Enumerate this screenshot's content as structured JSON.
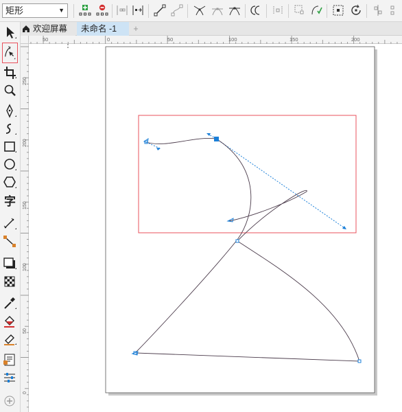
{
  "property_bar": {
    "object_type_value": "矩形",
    "icons": [
      "add-node-icon",
      "delete-node-icon",
      "join-nodes-icon",
      "break-curve-icon",
      "to-line-icon",
      "to-curve-icon",
      "cusp-node-icon",
      "smooth-node-icon",
      "symmetrical-node-icon",
      "reverse-direction-icon",
      "extend-curve-icon",
      "extract-subpath-icon",
      "close-curve-icon",
      "reduce-nodes-icon",
      "elastic-mode-icon",
      "select-all-nodes-icon",
      "rotate-nodes-icon",
      "align-nodes-icon"
    ]
  },
  "toolbox": {
    "tools": [
      "pick-tool",
      "shape-tool",
      "crop-tool",
      "zoom-tool",
      "freehand-tool",
      "artistic-media-tool",
      "rectangle-tool",
      "ellipse-tool",
      "polygon-tool",
      "text-tool",
      "parallel-dimension-tool",
      "connector-tool",
      "drop-shadow-tool",
      "transparency-tool",
      "eyedropper-tool",
      "interactive-fill-tool",
      "smart-fill-tool",
      "object-properties-tool",
      "color-palette-tool",
      "add-tool"
    ],
    "active_tool": "shape-tool",
    "text_tool_glyph": "字"
  },
  "tabs": {
    "welcome_label": "欢迎屏幕",
    "document_label": "未命名 -1",
    "add_label": "+"
  },
  "rulers": {
    "horizontal_labels": [
      "50",
      "0",
      "50",
      "100",
      "150",
      "200"
    ],
    "vertical_labels": [
      "250",
      "200",
      "150",
      "100",
      "50",
      "0"
    ]
  },
  "colors": {
    "selection_frame": "#e8505b",
    "node_handle": "#1a7fd8",
    "curve": "#4a3a4a",
    "page_shadow": "#c8c8c8",
    "accent_add": "#2ea043",
    "accent_delete": "#d32f2f"
  }
}
